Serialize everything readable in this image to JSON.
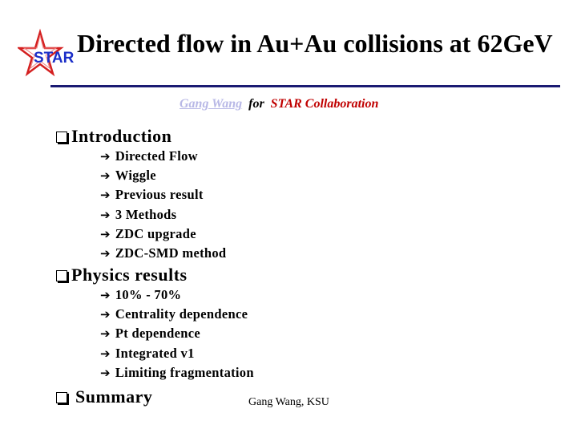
{
  "header": {
    "logo_text": "STAR",
    "title": "Directed flow in Au+Au collisions at 62GeV",
    "rule_color": "#1a1a72"
  },
  "byline": {
    "author": "Gang Wang",
    "connector": "for",
    "collaboration": "STAR Collaboration",
    "author_color": "#b8b8e6",
    "collaboration_color": "#c00000"
  },
  "sections": [
    {
      "icon": "checkbox-icon",
      "title": "Introduction",
      "items": [
        {
          "icon": "arrow-right-icon",
          "label": "Directed Flow"
        },
        {
          "icon": "arrow-right-icon",
          "label": "Wiggle"
        },
        {
          "icon": "arrow-right-icon",
          "label": "Previous result"
        },
        {
          "icon": "arrow-right-icon",
          "label": "3 Methods"
        },
        {
          "icon": "arrow-right-icon",
          "label": "ZDC upgrade"
        },
        {
          "icon": "arrow-right-icon",
          "label": "ZDC-SMD method"
        }
      ]
    },
    {
      "icon": "checkbox-icon",
      "title": "Physics results",
      "items": [
        {
          "icon": "arrow-right-icon",
          "label": "10% - 70%"
        },
        {
          "icon": "arrow-right-icon",
          "label": "Centrality dependence"
        },
        {
          "icon": "arrow-right-icon",
          "label": "Pt dependence"
        },
        {
          "icon": "arrow-right-icon",
          "label": "Integrated v1"
        },
        {
          "icon": "arrow-right-icon",
          "label": "Limiting fragmentation"
        }
      ]
    },
    {
      "icon": "checkbox-icon",
      "title": "Summary",
      "items": []
    }
  ],
  "footer": {
    "text": "Gang Wang, KSU"
  },
  "glyphs": {
    "arrow": "➔"
  }
}
